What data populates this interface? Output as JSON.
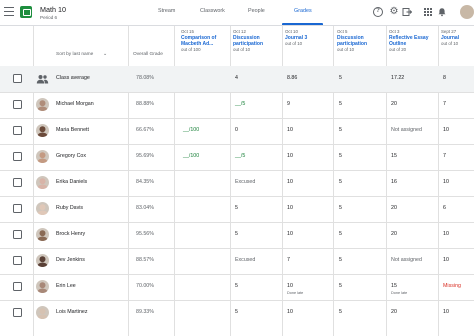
{
  "app": {
    "class_title": "Math 10",
    "class_subtitle": "Period 6",
    "brand_color": "#1e8e3e",
    "accent_color": "#1967d2",
    "tabs": [
      {
        "label": "Stream",
        "active": false
      },
      {
        "label": "Classwork",
        "active": false
      },
      {
        "label": "People",
        "active": false
      },
      {
        "label": "Grades",
        "active": true
      }
    ],
    "icons": [
      "menu-icon",
      "help-icon",
      "gear-icon",
      "grade-export-icon",
      "apps-icon",
      "avatar"
    ]
  },
  "grades": {
    "sort_label": "Sort by last name",
    "overall_header": "Overall Grade",
    "columns": [
      {
        "date": "Oct 15",
        "title_line1": "Comparison of",
        "title_line2": "Macbeth Ad...",
        "points": "out of 100"
      },
      {
        "date": "Oct 12",
        "title_line1": "Discussion",
        "title_line2": "participation",
        "points": "out of 10"
      },
      {
        "date": "Oct 10",
        "title_line1": "Journal 3",
        "title_line2": "",
        "points": "out of 10"
      },
      {
        "date": "Oct 5",
        "title_line1": "Discussion",
        "title_line2": "participation",
        "points": "out of 10"
      },
      {
        "date": "Oct 3",
        "title_line1": "Reflective Essay",
        "title_line2": "Outline",
        "points": "out of 20"
      },
      {
        "date": "Sept 27",
        "title_line1": "Journal",
        "title_line2": "",
        "points": "out of 10"
      }
    ],
    "class_average": {
      "label": "Class average",
      "overall": "78.08%",
      "cells": [
        "",
        "4",
        "8.86",
        "5",
        "17.22",
        "8"
      ]
    },
    "students": [
      {
        "name": "Michael Morgan",
        "overall": "88.88%",
        "cells": [
          "",
          "__/5",
          "9",
          "5",
          "20",
          "7"
        ],
        "notes": [
          "",
          "",
          "",
          "",
          "",
          ""
        ]
      },
      {
        "name": "Maria Bennett",
        "overall": "66.67%",
        "cells": [
          "__/100",
          "0",
          "10",
          "5",
          "Not assigned",
          "10"
        ],
        "notes": [
          "",
          "",
          "",
          "",
          "",
          ""
        ]
      },
      {
        "name": "Gregory Cox",
        "overall": "95.69%",
        "cells": [
          "__/100",
          "__/5",
          "10",
          "5",
          "15",
          "7"
        ],
        "notes": [
          "",
          "",
          "",
          "",
          "",
          ""
        ]
      },
      {
        "name": "Erika Daniels",
        "overall": "84.35%",
        "cells": [
          "",
          "Excused",
          "10",
          "5",
          "16",
          "10"
        ],
        "notes": [
          "",
          "",
          "",
          "",
          "",
          ""
        ]
      },
      {
        "name": "Ruby Davis",
        "overall": "83.04%",
        "cells": [
          "",
          "5",
          "10",
          "5",
          "20",
          "6"
        ],
        "notes": [
          "",
          "",
          "",
          "",
          "",
          ""
        ]
      },
      {
        "name": "Brock Henry",
        "overall": "95.56%",
        "cells": [
          "",
          "5",
          "10",
          "5",
          "20",
          "10"
        ],
        "notes": [
          "",
          "",
          "",
          "",
          "",
          ""
        ]
      },
      {
        "name": "Dev Jenkins",
        "overall": "88.57%",
        "cells": [
          "",
          "Excused",
          "7",
          "5",
          "Not assigned",
          "10"
        ],
        "notes": [
          "",
          "",
          "",
          "",
          "",
          ""
        ]
      },
      {
        "name": "Erin Lee",
        "overall": "70.00%",
        "cells": [
          "",
          "5",
          "10",
          "5",
          "15",
          "Missing"
        ],
        "notes": [
          "",
          "",
          "Done late",
          "",
          "Done late",
          ""
        ]
      },
      {
        "name": "Lois Martinez",
        "overall": "89.33%",
        "cells": [
          "",
          "5",
          "10",
          "5",
          "20",
          "10"
        ],
        "notes": [
          "",
          "",
          "",
          "",
          "",
          ""
        ]
      }
    ],
    "avatar_colors": [
      "#b08d7a",
      "#6b4a3a",
      "#c49a82",
      "#d8b4a8",
      "#e0c8b8",
      "#8a6a55",
      "#5a4036",
      "#a88878",
      "#d6c2b2"
    ]
  }
}
